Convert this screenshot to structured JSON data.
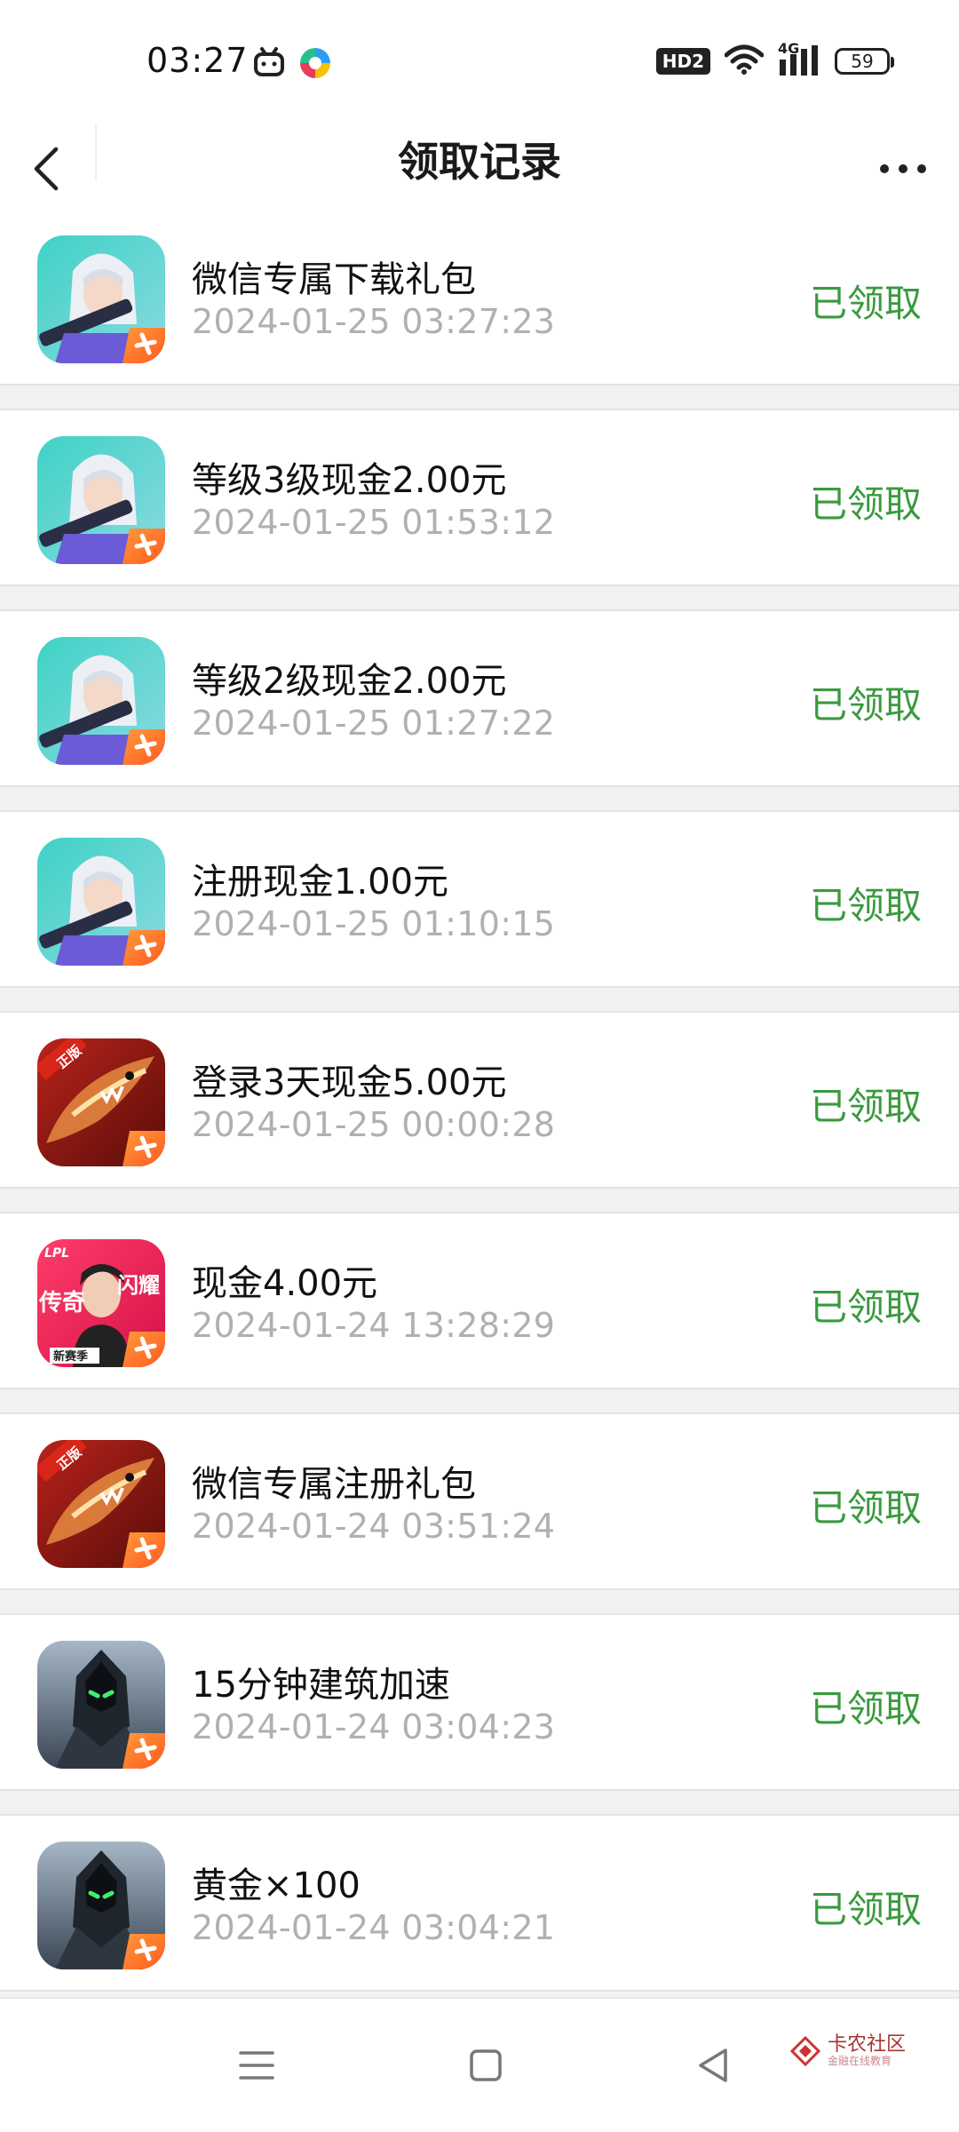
{
  "status_bar": {
    "time": "03:27",
    "hd_label": "HD2",
    "network_label": "4G",
    "battery_level": "59"
  },
  "header": {
    "title": "领取记录"
  },
  "records": [
    {
      "icon": "game-icon-hooded-girl",
      "title": "微信专属下载礼包",
      "time": "2024-01-25 03:27:23",
      "status": "已领取"
    },
    {
      "icon": "game-icon-hooded-girl",
      "title": "等级3级现金2.00元",
      "time": "2024-01-25 01:53:12",
      "status": "已领取"
    },
    {
      "icon": "game-icon-hooded-girl",
      "title": "等级2级现金2.00元",
      "time": "2024-01-25 01:27:22",
      "status": "已领取"
    },
    {
      "icon": "game-icon-hooded-girl",
      "title": "注册现金1.00元",
      "time": "2024-01-25 01:10:15",
      "status": "已领取"
    },
    {
      "icon": "game-icon-shark-plane",
      "title": "登录3天现金5.00元",
      "time": "2024-01-25 00:00:28",
      "status": "已领取"
    },
    {
      "icon": "game-icon-lpl-player",
      "title": "现金4.00元",
      "time": "2024-01-24 13:28:29",
      "status": "已领取"
    },
    {
      "icon": "game-icon-shark-plane",
      "title": "微信专属注册礼包",
      "time": "2024-01-24 03:51:24",
      "status": "已领取"
    },
    {
      "icon": "game-icon-dark-knight",
      "title": "15分钟建筑加速",
      "time": "2024-01-24 03:04:23",
      "status": "已领取"
    },
    {
      "icon": "game-icon-dark-knight",
      "title": "黄金×100",
      "time": "2024-01-24 03:04:21",
      "status": "已领取"
    }
  ],
  "icon_text": {
    "shark_badge": "正版",
    "lpl_badge": "LPL",
    "lpl_left": "传奇",
    "lpl_right": "闪耀",
    "lpl_bottom": "新赛季"
  },
  "watermark": {
    "main": "卡农社区",
    "sub": "金融在线教育"
  },
  "colors": {
    "status_green": "#3a9a3e",
    "timestamp_gray": "#b0b0b0",
    "separator_gray": "#f1f1f3"
  }
}
